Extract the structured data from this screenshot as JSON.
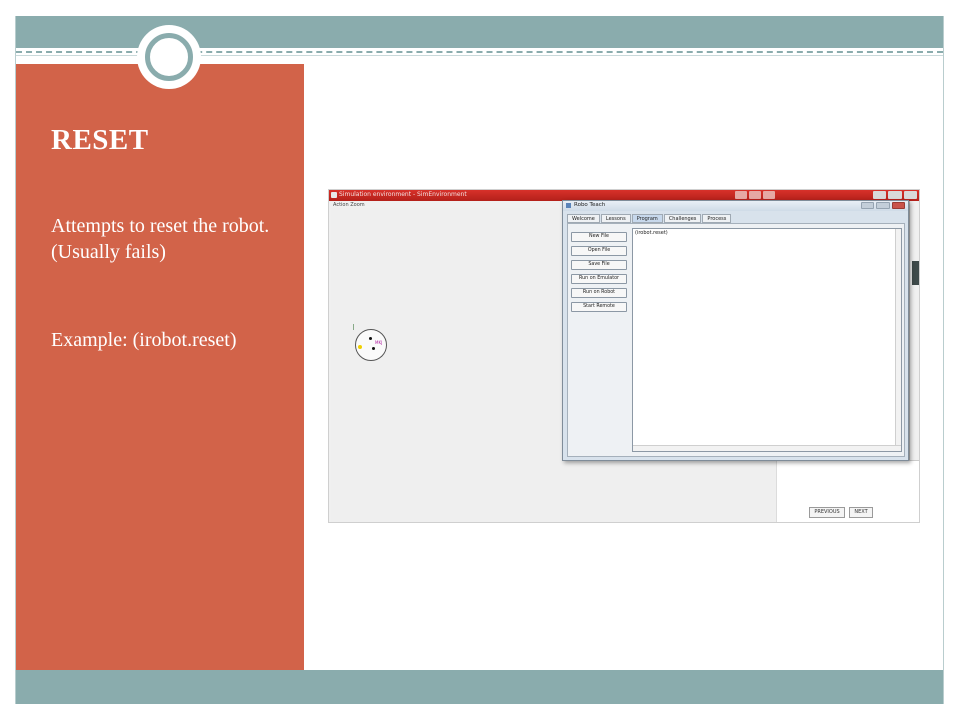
{
  "slide": {
    "title": "RESET",
    "body": "Attempts to reset the robot. (Usually fails)",
    "example": "Example: (irobot.reset)"
  },
  "colors": {
    "accent": "#8aacad",
    "panel": "#d26349",
    "text_on_panel": "#ffffff"
  },
  "screenshot": {
    "sim_window_title": "Simulation environment - SimEnvironment",
    "sim_menu": "Action  Zoom",
    "robot_label": "MKJ",
    "robo_teach": {
      "title": "Robo Teach",
      "tabs": [
        "Welcome",
        "Lessons",
        "Program",
        "Challenges",
        "Process"
      ],
      "active_tab": "Program",
      "buttons": [
        "New File",
        "Open File",
        "Save File",
        "Run on Emulator",
        "Run on Robot",
        "Start Remote"
      ],
      "editor_text": "(irobot.reset)"
    },
    "nav_buttons": [
      "PREVIOUS",
      "NEXT"
    ]
  }
}
